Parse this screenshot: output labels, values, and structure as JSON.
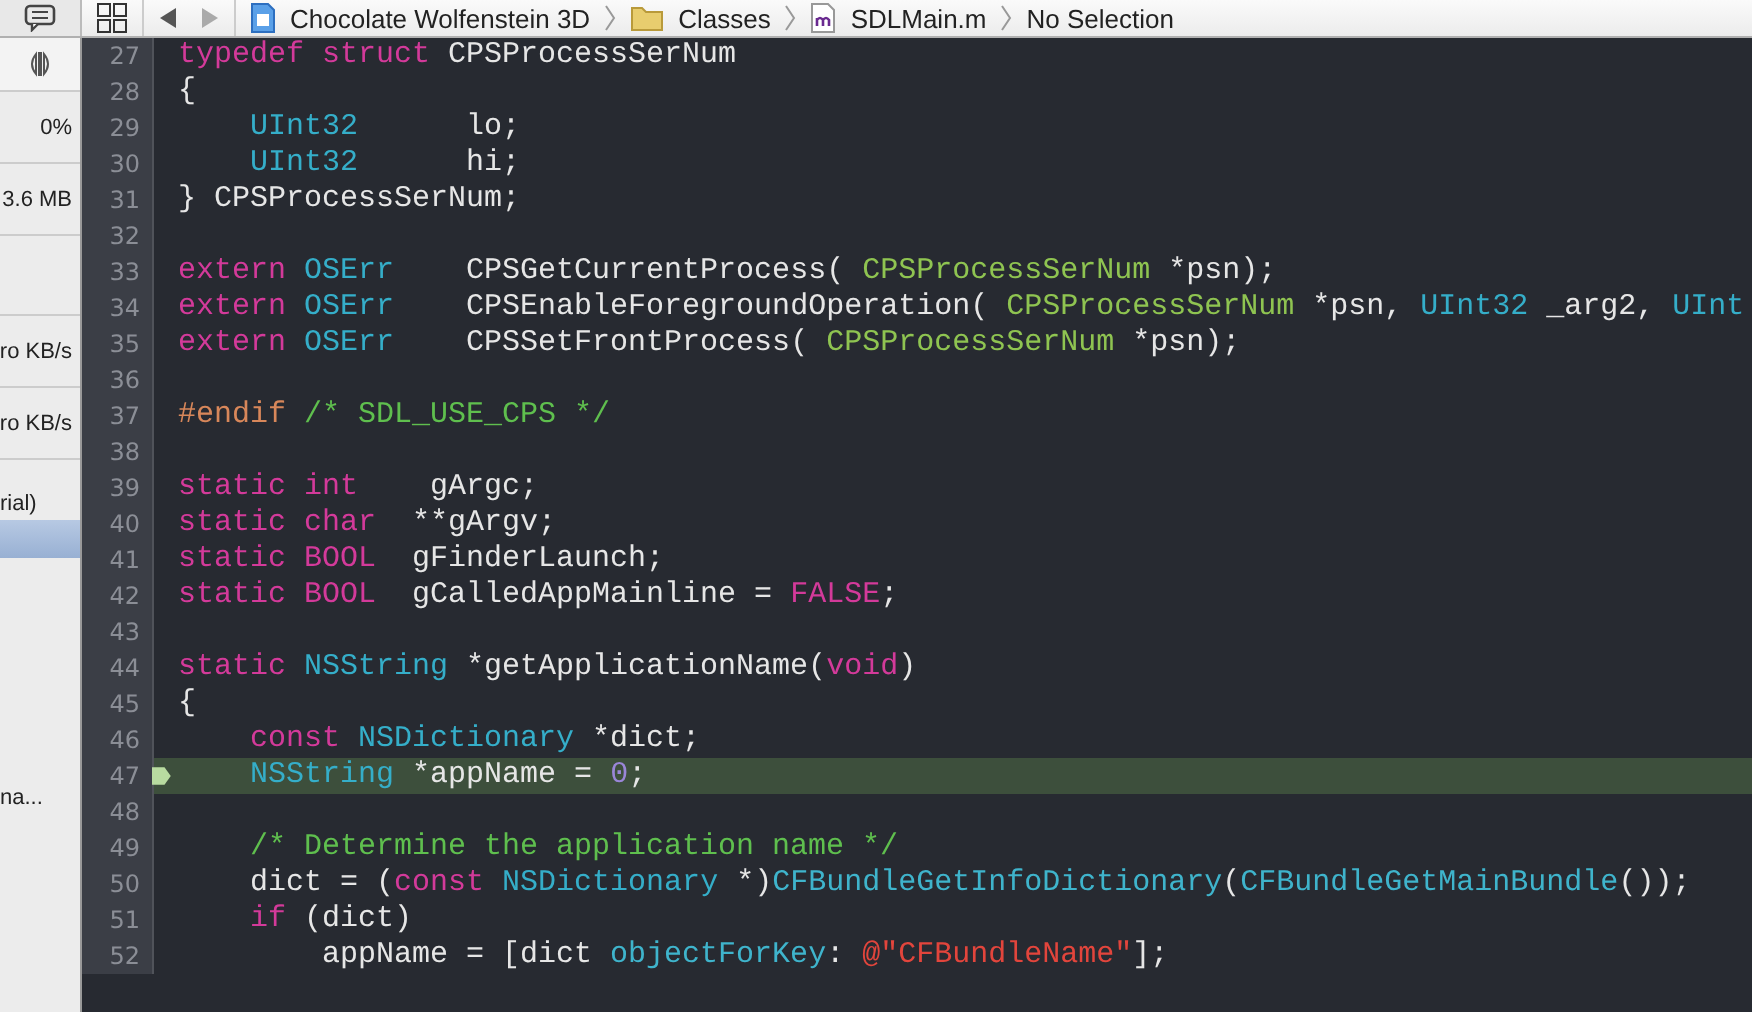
{
  "jump_bar": {
    "crumbs": [
      {
        "kind": "project",
        "text": "Chocolate Wolfenstein 3D"
      },
      {
        "kind": "folder",
        "text": "Classes"
      },
      {
        "kind": "mfile",
        "text": "SDLMain.m"
      },
      {
        "kind": "none",
        "text": "No Selection"
      }
    ]
  },
  "debug_panel": {
    "rows": [
      {
        "kind": "value",
        "text": "0%",
        "selected": false
      },
      {
        "kind": "value",
        "text": "3.6 MB",
        "selected": false
      },
      {
        "kind": "blank",
        "selected": false
      },
      {
        "kind": "value",
        "text": "ro KB/s",
        "selected": false
      },
      {
        "kind": "value",
        "text": "ro KB/s",
        "selected": false
      },
      {
        "kind": "label",
        "text": "rial)",
        "selected": false
      },
      {
        "kind": "blank",
        "selected": true
      },
      {
        "kind": "note",
        "text": "na...",
        "selected": false
      }
    ]
  },
  "editor": {
    "lines": [
      {
        "number": "27",
        "current": false,
        "tokens": [
          {
            "kind": "keyword",
            "text": "typedef "
          },
          {
            "kind": "keyword",
            "text": "struct"
          },
          {
            "kind": "plain",
            "text": " CPSProcessSerNum"
          }
        ]
      },
      {
        "number": "28",
        "current": false,
        "tokens": [
          {
            "kind": "plain",
            "text": "{"
          }
        ]
      },
      {
        "number": "29",
        "current": false,
        "tokens": [
          {
            "kind": "type",
            "text": "    UInt32"
          },
          {
            "kind": "plain",
            "text": "      lo;"
          }
        ]
      },
      {
        "number": "30",
        "current": false,
        "tokens": [
          {
            "kind": "type",
            "text": "    UInt32"
          },
          {
            "kind": "plain",
            "text": "      hi;"
          }
        ]
      },
      {
        "number": "31",
        "current": false,
        "tokens": [
          {
            "kind": "plain",
            "text": "} CPSProcessSerNum;"
          }
        ]
      },
      {
        "number": "32",
        "current": false
      },
      {
        "number": "33",
        "current": false,
        "tokens": [
          {
            "kind": "keyword",
            "text": "extern "
          },
          {
            "kind": "type",
            "text": "OSErr"
          },
          {
            "kind": "plain",
            "text": "    CPSGetCurrentProcess( "
          },
          {
            "kind": "project",
            "text": "CPSProcessSerNum"
          },
          {
            "kind": "plain",
            "text": " *psn);"
          }
        ]
      },
      {
        "number": "34",
        "current": false,
        "tokens": [
          {
            "kind": "keyword",
            "text": "extern "
          },
          {
            "kind": "type",
            "text": "OSErr"
          },
          {
            "kind": "plain",
            "text": "    CPSEnableForegroundOperation( "
          },
          {
            "kind": "project",
            "text": "CPSProcessSerNum"
          },
          {
            "kind": "plain",
            "text": " *psn, "
          },
          {
            "kind": "type",
            "text": "UInt32"
          },
          {
            "kind": "plain",
            "text": " _arg2, "
          },
          {
            "kind": "type",
            "text": "UInt"
          }
        ]
      },
      {
        "number": "35",
        "current": false,
        "tokens": [
          {
            "kind": "keyword",
            "text": "extern "
          },
          {
            "kind": "type",
            "text": "OSErr"
          },
          {
            "kind": "plain",
            "text": "    CPSSetFrontProcess( "
          },
          {
            "kind": "project",
            "text": "CPSProcessSerNum"
          },
          {
            "kind": "plain",
            "text": " *psn);"
          }
        ]
      },
      {
        "number": "36",
        "current": false
      },
      {
        "number": "37",
        "current": false,
        "tokens": [
          {
            "kind": "preprocessor",
            "text": "#endif "
          },
          {
            "kind": "comment",
            "text": "/* SDL_USE_CPS */"
          }
        ]
      },
      {
        "number": "38",
        "current": false
      },
      {
        "number": "39",
        "current": false,
        "tokens": [
          {
            "kind": "keyword",
            "text": "static "
          },
          {
            "kind": "keyword",
            "text": "int"
          },
          {
            "kind": "plain",
            "text": "    gArgc;"
          }
        ]
      },
      {
        "number": "40",
        "current": false,
        "tokens": [
          {
            "kind": "keyword",
            "text": "static "
          },
          {
            "kind": "keyword",
            "text": "char"
          },
          {
            "kind": "plain",
            "text": "  **gArgv;"
          }
        ]
      },
      {
        "number": "41",
        "current": false,
        "tokens": [
          {
            "kind": "keyword",
            "text": "static "
          },
          {
            "kind": "keyword",
            "text": "BOOL"
          },
          {
            "kind": "plain",
            "text": "  gFinderLaunch;"
          }
        ]
      },
      {
        "number": "42",
        "current": false,
        "tokens": [
          {
            "kind": "keyword",
            "text": "static "
          },
          {
            "kind": "keyword",
            "text": "BOOL"
          },
          {
            "kind": "plain",
            "text": "  gCalledAppMainline = "
          },
          {
            "kind": "keyword",
            "text": "FALSE"
          },
          {
            "kind": "plain",
            "text": ";"
          }
        ]
      },
      {
        "number": "43",
        "current": false
      },
      {
        "number": "44",
        "current": false,
        "tokens": [
          {
            "kind": "keyword",
            "text": "static "
          },
          {
            "kind": "type",
            "text": "NSString"
          },
          {
            "kind": "plain",
            "text": " *getApplicationName("
          },
          {
            "kind": "keyword",
            "text": "void"
          },
          {
            "kind": "plain",
            "text": ")"
          }
        ]
      },
      {
        "number": "45",
        "current": false,
        "tokens": [
          {
            "kind": "plain",
            "text": "{"
          }
        ]
      },
      {
        "number": "46",
        "current": false,
        "tokens": [
          {
            "kind": "keyword",
            "text": "    const "
          },
          {
            "kind": "type",
            "text": "NSDictionary"
          },
          {
            "kind": "plain",
            "text": " *dict;"
          }
        ]
      },
      {
        "number": "47",
        "current": true,
        "tokens": [
          {
            "kind": "type",
            "text": "    NSString"
          },
          {
            "kind": "plain",
            "text": " *appName = "
          },
          {
            "kind": "number",
            "text": "0"
          },
          {
            "kind": "plain",
            "text": ";"
          }
        ]
      },
      {
        "number": "48",
        "current": false
      },
      {
        "number": "49",
        "current": false,
        "tokens": [
          {
            "kind": "comment",
            "text": "    /* Determine the application name */"
          }
        ]
      },
      {
        "number": "50",
        "current": false,
        "tokens": [
          {
            "kind": "plain",
            "text": "    dict = ("
          },
          {
            "kind": "keyword",
            "text": "const "
          },
          {
            "kind": "type",
            "text": "NSDictionary"
          },
          {
            "kind": "plain",
            "text": " *)"
          },
          {
            "kind": "function",
            "text": "CFBundleGetInfoDictionary"
          },
          {
            "kind": "plain",
            "text": "("
          },
          {
            "kind": "function",
            "text": "CFBundleGetMainBundle"
          },
          {
            "kind": "plain",
            "text": "());"
          }
        ]
      },
      {
        "number": "51",
        "current": false,
        "tokens": [
          {
            "kind": "keyword",
            "text": "    if"
          },
          {
            "kind": "plain",
            "text": " (dict)"
          }
        ]
      },
      {
        "number": "52",
        "current": false,
        "tokens": [
          {
            "kind": "plain",
            "text": "        appName = [dict "
          },
          {
            "kind": "function",
            "text": "objectForKey"
          },
          {
            "kind": "plain",
            "text": ": "
          },
          {
            "kind": "string",
            "text": "@\"CFBundleName\""
          },
          {
            "kind": "plain",
            "text": "];"
          }
        ]
      }
    ]
  }
}
